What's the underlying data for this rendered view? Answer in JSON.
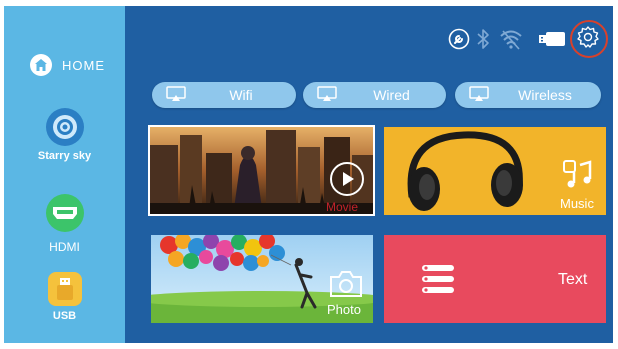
{
  "sidebar": {
    "home_label": "HOME",
    "items": [
      {
        "label": "Starry sky",
        "icon": "starry-sky-icon"
      },
      {
        "label": "HDMI",
        "icon": "hdmi-icon"
      },
      {
        "label": "USB",
        "icon": "usb-icon"
      }
    ]
  },
  "status_icons": [
    "wrench-icon",
    "bluetooth-icon",
    "wifi-icon",
    "usb-drive-icon",
    "settings-gear-icon"
  ],
  "connect_buttons": [
    {
      "label": "Wifi"
    },
    {
      "label": "Wired"
    },
    {
      "label": "Wireless"
    }
  ],
  "tiles": {
    "movie": {
      "label": "Movie"
    },
    "music": {
      "label": "Music"
    },
    "photo": {
      "label": "Photo"
    },
    "text": {
      "label": "Text"
    }
  },
  "colors": {
    "sidebar": "#5bb7e4",
    "main": "#1f5fa2",
    "music_tile": "#f2b42a",
    "text_tile": "#e84a5e",
    "hdmi_green": "#3cc46a",
    "usb_yellow": "#f5c23c",
    "highlight_ring": "#d8412b"
  }
}
